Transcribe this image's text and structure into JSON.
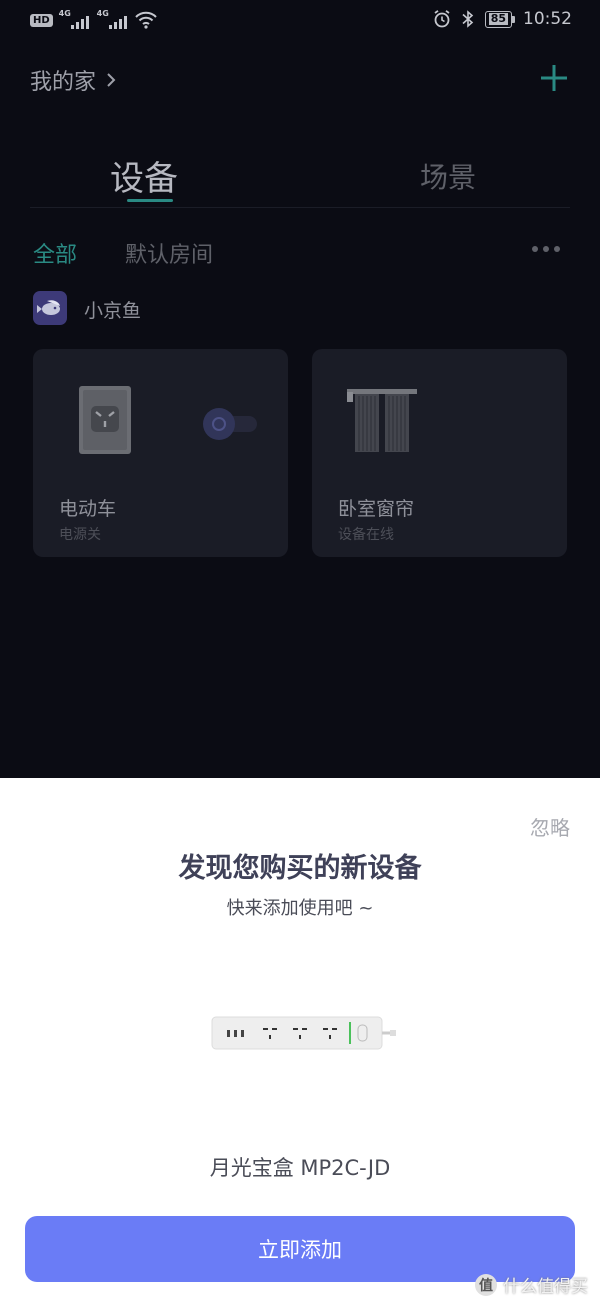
{
  "status_bar": {
    "hd_badge": "HD",
    "network_1": "4G",
    "network_2": "4G",
    "battery": "85",
    "time": "10:52",
    "icons": [
      "wifi-icon",
      "alarm-icon",
      "bluetooth-icon",
      "battery-icon"
    ]
  },
  "header": {
    "home_title": "我的家",
    "add_icon": "plus-icon"
  },
  "tabs": [
    {
      "label": "设备",
      "active": true
    },
    {
      "label": "场景",
      "active": false
    }
  ],
  "filters": [
    {
      "label": "全部",
      "active": true
    },
    {
      "label": "默认房间",
      "active": false
    }
  ],
  "group": {
    "name": "小京鱼"
  },
  "devices": [
    {
      "name": "电动车",
      "status": "电源关",
      "icon": "socket-icon",
      "toggle": "off"
    },
    {
      "name": "卧室窗帘",
      "status": "设备在线",
      "icon": "curtain-icon"
    }
  ],
  "sheet": {
    "ignore": "忽略",
    "title": "发现您购买的新设备",
    "subtitle": "快来添加使用吧 ~",
    "product_name": "月光宝盒 MP2C-JD",
    "add_button": "立即添加"
  },
  "watermark": {
    "logo": "值",
    "text": "什么值得买"
  },
  "colors": {
    "background": "#0b0c14",
    "accent_teal": "#2a8a83",
    "card": "#1a1c26",
    "primary_button": "#6a7cf6",
    "sheet": "#ffffff"
  }
}
